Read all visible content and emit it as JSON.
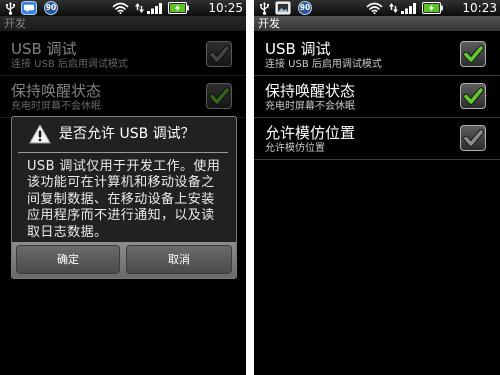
{
  "colors": {
    "check_on": "#62c92b",
    "check_off": "#8a8a8a",
    "battery_charge": "#5bc424",
    "badge": "#2a5796",
    "notification_blue": "#3b84d8"
  },
  "screens": [
    {
      "status_bar": {
        "notification_icons": [
          "usb-icon",
          "chat-notification-icon"
        ],
        "badge": "90",
        "system_icons": [
          "wifi-icon",
          "data-activity-icon",
          "signal-icon",
          "battery-charging-icon"
        ],
        "time": "10:25"
      },
      "title": "开发",
      "settings": [
        {
          "title": "USB 调试",
          "summary": "连接 USB 后启用调试模式",
          "checked": false
        },
        {
          "title": "保持唤醒状态",
          "summary": "充电时屏幕不会休眠",
          "checked": true
        }
      ],
      "dialog": {
        "icon": "warning-icon",
        "title": "是否允许 USB 调试？",
        "message_lines": [
          "USB 调试仅用于开发工作。使用",
          "该功能可在计算机和移动设备之",
          "间复制数据、在移动设备上安装",
          "应用程序而不进行通知，以及读",
          "取日志数据。"
        ],
        "ok_label": "确定",
        "cancel_label": "取消"
      }
    },
    {
      "status_bar": {
        "notification_icons": [
          "usb-icon",
          "picture-notification-icon"
        ],
        "badge": "90",
        "system_icons": [
          "wifi-icon",
          "data-activity-icon",
          "signal-icon",
          "battery-charging-icon"
        ],
        "time": "10:23"
      },
      "title": "开发",
      "settings": [
        {
          "title": "USB 调试",
          "summary": "连接 USB 后启用调试模式",
          "checked": true
        },
        {
          "title": "保持唤醒状态",
          "summary": "充电时屏幕不会休眠",
          "checked": true
        },
        {
          "title": "允许模仿位置",
          "summary": "允许模仿位置",
          "checked": false
        }
      ]
    }
  ]
}
